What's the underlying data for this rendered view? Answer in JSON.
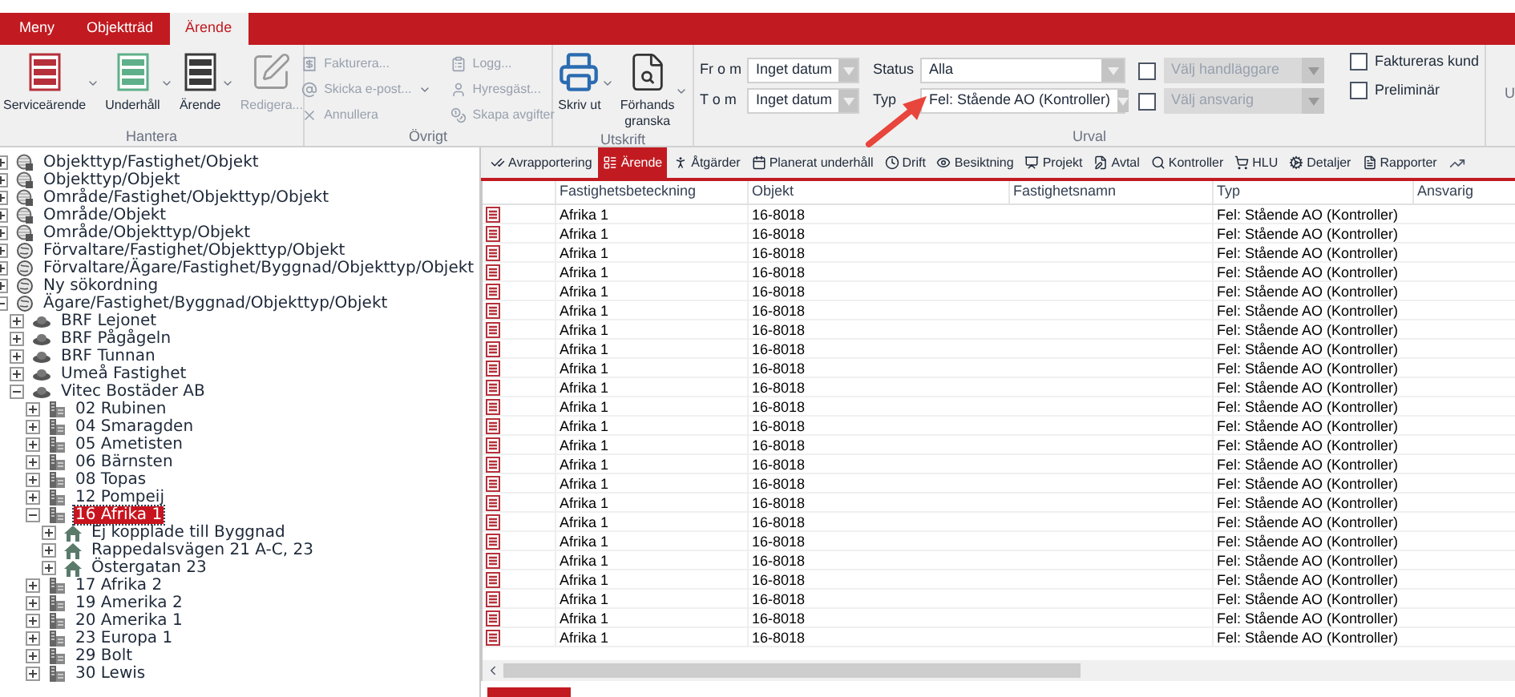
{
  "menu_tabs": [
    {
      "label": "Meny",
      "selected": false
    },
    {
      "label": "Objektträd",
      "selected": false
    },
    {
      "label": "Ärende",
      "selected": true
    }
  ],
  "ribbon": {
    "groups": [
      {
        "kind": "large",
        "label": "Hantera",
        "buttons": [
          {
            "label": "Serviceärende",
            "color": "#b5303a",
            "dropdown": true,
            "disabled": false
          },
          {
            "label": "Underhåll",
            "color": "#5fb08a",
            "dropdown": true,
            "disabled": false
          },
          {
            "label": "Ärende",
            "color": "#3a3a3a",
            "dropdown": true,
            "disabled": false
          },
          {
            "label": "Redigera...",
            "color": "#9a9a9a",
            "dropdown": false,
            "disabled": true
          }
        ]
      },
      {
        "kind": "small",
        "label": "Övrigt",
        "columns": [
          [
            {
              "label": "Fakturera...",
              "dropdown": false,
              "disabled": true
            },
            {
              "label": "Skicka e-post...",
              "dropdown": true,
              "disabled": true
            },
            {
              "label": "Annullera",
              "dropdown": false,
              "disabled": true
            }
          ],
          [
            {
              "label": "Logg...",
              "dropdown": false,
              "disabled": true
            },
            {
              "label": "Hyresgäst...",
              "dropdown": false,
              "disabled": true
            },
            {
              "label": "Skapa avgifter",
              "dropdown": false,
              "disabled": true
            }
          ]
        ]
      },
      {
        "kind": "large",
        "label": "Utskrift",
        "buttons": [
          {
            "label": "Skriv ut",
            "color": "#2b6cb0",
            "dropdown": true,
            "disabled": false
          },
          {
            "label": "Förhands granska",
            "color": "#333333",
            "dropdown": true,
            "disabled": false
          }
        ]
      },
      {
        "kind": "filters",
        "label": "Urval",
        "dates": [
          {
            "label": "Fr o m",
            "value": "Inget datum"
          },
          {
            "label": "T o m",
            "value": "Inget datum"
          }
        ],
        "selects": [
          {
            "label": "Status",
            "value": "Alla"
          },
          {
            "label": "Typ",
            "value": "Fel: Stående AO (Kontroller)"
          }
        ],
        "pickers": [
          {
            "checked": false,
            "placeholder": "Välj handläggare",
            "disabled": true
          },
          {
            "checked": false,
            "placeholder": "Välj ansvarig",
            "disabled": true
          }
        ],
        "options": [
          {
            "label": "Faktureras kund",
            "checked": false
          },
          {
            "label": "Preliminär",
            "checked": false
          }
        ]
      }
    ],
    "overflow_label": "U"
  },
  "tree": [
    {
      "label": "Objekttyp/Fastighet/Objekt",
      "kind": "saved",
      "expanded": false,
      "selected": false
    },
    {
      "label": "Objekttyp/Objekt",
      "kind": "saved",
      "expanded": false,
      "selected": false
    },
    {
      "label": "Område/Fastighet/Objekttyp/Objekt",
      "kind": "saved",
      "expanded": false,
      "selected": false
    },
    {
      "label": "Område/Objekt",
      "kind": "saved",
      "expanded": false,
      "selected": false
    },
    {
      "label": "Område/Objekttyp/Objekt",
      "kind": "saved",
      "expanded": false,
      "selected": false
    },
    {
      "label": "Förvaltare/Fastighet/Objekttyp/Objekt",
      "kind": "search",
      "expanded": false,
      "selected": false
    },
    {
      "label": "Förvaltare/Ägare/Fastighet/Byggnad/Objekttyp/Objekt",
      "kind": "search",
      "expanded": false,
      "selected": false
    },
    {
      "label": "Ny sökordning",
      "kind": "search",
      "expanded": false,
      "selected": false
    },
    {
      "label": "Ägare/Fastighet/Byggnad/Objekttyp/Objekt",
      "kind": "search",
      "expanded": true,
      "selected": false,
      "children": [
        {
          "label": "BRF Lejonet",
          "kind": "owner",
          "expanded": false,
          "selected": false
        },
        {
          "label": "BRF Pågågeln",
          "kind": "owner",
          "expanded": false,
          "selected": false
        },
        {
          "label": "BRF Tunnan",
          "kind": "owner",
          "expanded": false,
          "selected": false
        },
        {
          "label": "Umeå Fastighet",
          "kind": "owner",
          "expanded": false,
          "selected": false
        },
        {
          "label": "Vitec Bostäder AB",
          "kind": "owner",
          "expanded": true,
          "selected": false,
          "children": [
            {
              "label": "02 Rubinen",
              "kind": "property",
              "expanded": false,
              "selected": false
            },
            {
              "label": "04 Smaragden",
              "kind": "property",
              "expanded": false,
              "selected": false
            },
            {
              "label": "05 Ametisten",
              "kind": "property",
              "expanded": false,
              "selected": false
            },
            {
              "label": "06 Bärnsten",
              "kind": "property",
              "expanded": false,
              "selected": false
            },
            {
              "label": "08 Topas",
              "kind": "property",
              "expanded": false,
              "selected": false
            },
            {
              "label": "12 Pompeij",
              "kind": "property",
              "expanded": false,
              "selected": false
            },
            {
              "label": "16 Afrika 1",
              "kind": "property",
              "expanded": true,
              "selected": true,
              "children": [
                {
                  "label": "Ej kopplade till Byggnad",
                  "kind": "building",
                  "expanded": false,
                  "selected": false
                },
                {
                  "label": "Rappedalsvägen 21 A-C, 23",
                  "kind": "building",
                  "expanded": false,
                  "selected": false
                },
                {
                  "label": "Östergatan 23",
                  "kind": "building",
                  "expanded": false,
                  "selected": false
                }
              ]
            },
            {
              "label": "17 Afrika 2",
              "kind": "property",
              "expanded": false,
              "selected": false
            },
            {
              "label": "19 Amerika 2",
              "kind": "property",
              "expanded": false,
              "selected": false
            },
            {
              "label": "20 Amerika 1",
              "kind": "property",
              "expanded": false,
              "selected": false
            },
            {
              "label": "23 Europa 1",
              "kind": "property",
              "expanded": false,
              "selected": false
            },
            {
              "label": "29 Bolt",
              "kind": "property",
              "expanded": false,
              "selected": false
            },
            {
              "label": "30 Lewis",
              "kind": "property",
              "expanded": false,
              "selected": false
            }
          ]
        }
      ]
    }
  ],
  "view_tabs": [
    {
      "label": "Avrapportering",
      "selected": false
    },
    {
      "label": "Ärende",
      "selected": true
    },
    {
      "label": "Åtgärder",
      "selected": false
    },
    {
      "label": "Planerat underhåll",
      "selected": false
    },
    {
      "label": "Drift",
      "selected": false
    },
    {
      "label": "Besiktning",
      "selected": false
    },
    {
      "label": "Projekt",
      "selected": false
    },
    {
      "label": "Avtal",
      "selected": false
    },
    {
      "label": "Kontroller",
      "selected": false
    },
    {
      "label": "HLU",
      "selected": false
    },
    {
      "label": "Detaljer",
      "selected": false
    },
    {
      "label": "Rapporter",
      "selected": false
    }
  ],
  "table": {
    "columns": [
      "Fastighetsbeteckning",
      "Objekt",
      "Fastighetsnamn",
      "Typ",
      "Ansvarig"
    ],
    "rows": [
      {
        "fastighetsbeteckning": "Afrika 1",
        "objekt": "16-8018",
        "typ": "Fel: Stående AO (Kontroller)"
      },
      {
        "fastighetsbeteckning": "Afrika 1",
        "objekt": "16-8018",
        "typ": "Fel: Stående AO (Kontroller)"
      },
      {
        "fastighetsbeteckning": "Afrika 1",
        "objekt": "16-8018",
        "typ": "Fel: Stående AO (Kontroller)"
      },
      {
        "fastighetsbeteckning": "Afrika 1",
        "objekt": "16-8018",
        "typ": "Fel: Stående AO (Kontroller)"
      },
      {
        "fastighetsbeteckning": "Afrika 1",
        "objekt": "16-8018",
        "typ": "Fel: Stående AO (Kontroller)"
      },
      {
        "fastighetsbeteckning": "Afrika 1",
        "objekt": "16-8018",
        "typ": "Fel: Stående AO (Kontroller)"
      },
      {
        "fastighetsbeteckning": "Afrika 1",
        "objekt": "16-8018",
        "typ": "Fel: Stående AO (Kontroller)"
      },
      {
        "fastighetsbeteckning": "Afrika 1",
        "objekt": "16-8018",
        "typ": "Fel: Stående AO (Kontroller)"
      },
      {
        "fastighetsbeteckning": "Afrika 1",
        "objekt": "16-8018",
        "typ": "Fel: Stående AO (Kontroller)"
      },
      {
        "fastighetsbeteckning": "Afrika 1",
        "objekt": "16-8018",
        "typ": "Fel: Stående AO (Kontroller)"
      },
      {
        "fastighetsbeteckning": "Afrika 1",
        "objekt": "16-8018",
        "typ": "Fel: Stående AO (Kontroller)"
      },
      {
        "fastighetsbeteckning": "Afrika 1",
        "objekt": "16-8018",
        "typ": "Fel: Stående AO (Kontroller)"
      },
      {
        "fastighetsbeteckning": "Afrika 1",
        "objekt": "16-8018",
        "typ": "Fel: Stående AO (Kontroller)"
      },
      {
        "fastighetsbeteckning": "Afrika 1",
        "objekt": "16-8018",
        "typ": "Fel: Stående AO (Kontroller)"
      },
      {
        "fastighetsbeteckning": "Afrika 1",
        "objekt": "16-8018",
        "typ": "Fel: Stående AO (Kontroller)"
      },
      {
        "fastighetsbeteckning": "Afrika 1",
        "objekt": "16-8018",
        "typ": "Fel: Stående AO (Kontroller)"
      },
      {
        "fastighetsbeteckning": "Afrika 1",
        "objekt": "16-8018",
        "typ": "Fel: Stående AO (Kontroller)"
      },
      {
        "fastighetsbeteckning": "Afrika 1",
        "objekt": "16-8018",
        "typ": "Fel: Stående AO (Kontroller)"
      },
      {
        "fastighetsbeteckning": "Afrika 1",
        "objekt": "16-8018",
        "typ": "Fel: Stående AO (Kontroller)"
      },
      {
        "fastighetsbeteckning": "Afrika 1",
        "objekt": "16-8018",
        "typ": "Fel: Stående AO (Kontroller)"
      },
      {
        "fastighetsbeteckning": "Afrika 1",
        "objekt": "16-8018",
        "typ": "Fel: Stående AO (Kontroller)"
      },
      {
        "fastighetsbeteckning": "Afrika 1",
        "objekt": "16-8018",
        "typ": "Fel: Stående AO (Kontroller)"
      },
      {
        "fastighetsbeteckning": "Afrika 1",
        "objekt": "16-8018",
        "typ": "Fel: Stående AO (Kontroller)"
      }
    ]
  },
  "annotations": [
    {
      "kind": "arrow",
      "color": "#e8453c"
    }
  ]
}
